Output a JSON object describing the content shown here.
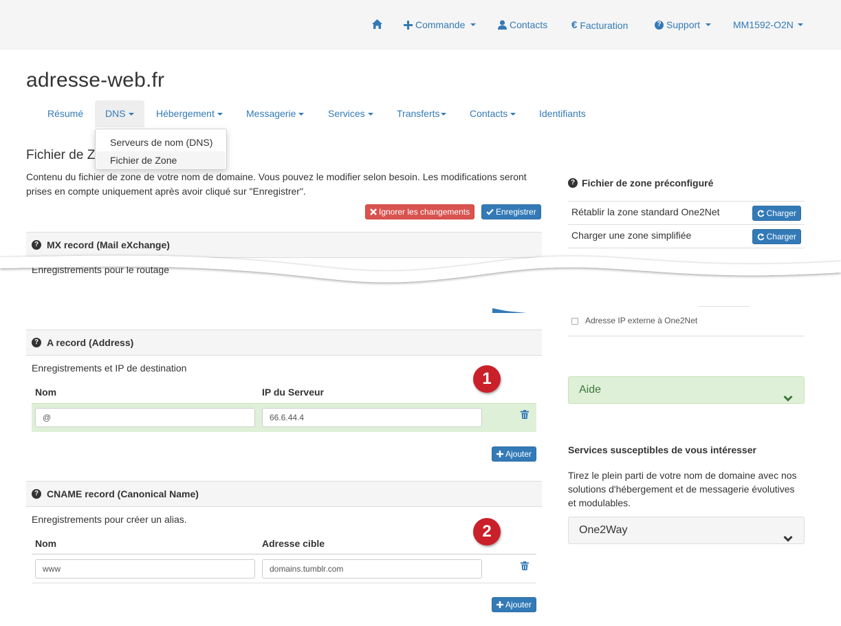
{
  "topnav": {
    "home_icon": "home-icon",
    "commande": "Commande",
    "contacts": "Contacts",
    "facturation": "Facturation",
    "support": "Support",
    "account": "MM1592-O2N"
  },
  "site": {
    "title": "adresse-web.fr"
  },
  "subnav": {
    "resume": "Résumé",
    "dns": "DNS",
    "hebergement": "Hébergement",
    "messagerie": "Messagerie",
    "services": "Services",
    "transferts": "Transferts",
    "contacts": "Contacts",
    "identifiants": "Identifiants"
  },
  "dropdown": {
    "items": [
      "Serveurs de nom (DNS)",
      "Fichier de Zone"
    ]
  },
  "page": {
    "heading": "Fichier de Zone",
    "intro": "Contenu du fichier de zone de votre nom de domaine. Vous pouvez le modifier selon besoin. Les modifications seront prises en compte uniquement après avoir cliqué sur \"Enregistrer\".",
    "ignore_button": "Ignorer les changements",
    "save_button": "Enregistrer"
  },
  "mx": {
    "title": "MX record (Mail eXchange)",
    "desc_fragment": "Enregistrements pour le routage"
  },
  "a_record": {
    "title": "A record (Address)",
    "desc": "Enregistrements et IP de destination",
    "col_name": "Nom",
    "col_ip": "IP du Serveur",
    "rows": [
      {
        "name": "@",
        "ip": "66.6.44.4"
      }
    ],
    "add_button": "Ajouter",
    "callout": "1"
  },
  "cname": {
    "title": "CNAME record (Canonical Name)",
    "desc": "Enregistrements pour créer un alias.",
    "col_name": "Nom",
    "col_target": "Adresse cible",
    "rows": [
      {
        "name": "www",
        "target": "domains.tumblr.com"
      }
    ],
    "add_button": "Ajouter",
    "callout": "2"
  },
  "sidebar": {
    "preset_title": "Fichier de zone préconfiguré",
    "preset_rows": [
      {
        "label": "Rétablir la zone standard One2Net",
        "button": "Charger"
      },
      {
        "label": "Charger une zone simplifiée",
        "button": "Charger"
      }
    ],
    "fragment_option": "Adresse IP externe à One2Net",
    "help_label": "Aide",
    "services_title": "Services susceptibles de vous intéresser",
    "services_text": "Tirez le plein parti de votre nom de domaine avec nos solutions d'hébergement et de messagerie évolutives et modulables.",
    "one2way_label": "One2Way"
  },
  "colors": {
    "link": "#337ab7",
    "danger": "#d9534f",
    "primary": "#337ab7",
    "success_bg": "#dff0d8",
    "callout": "#c9202a"
  }
}
